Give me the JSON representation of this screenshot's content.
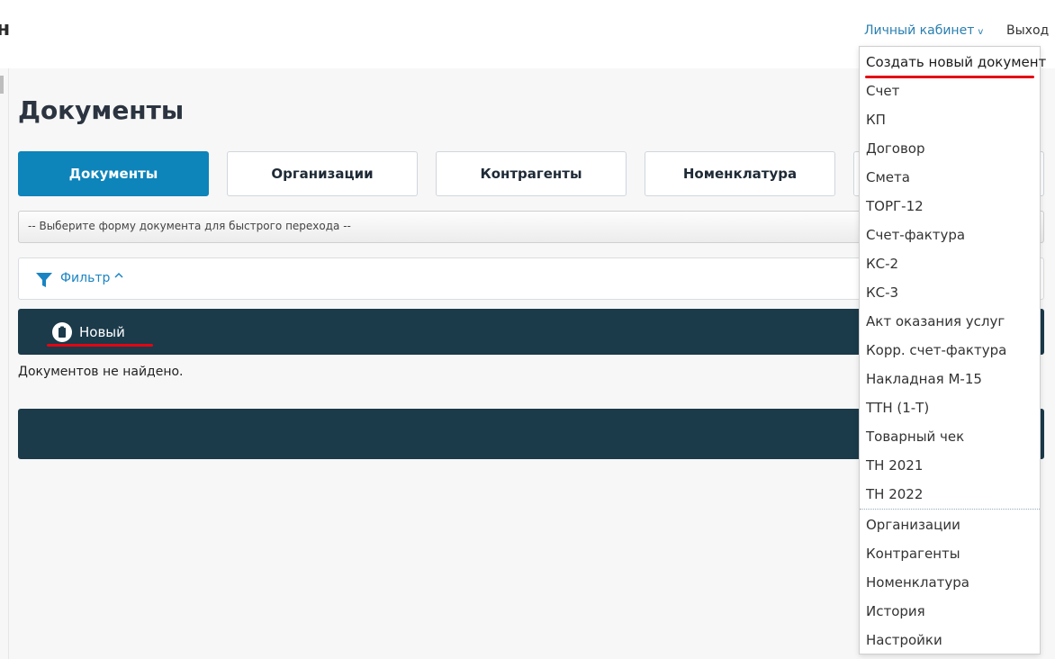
{
  "header": {
    "brand_fragment": "н",
    "account_label": "Личный кабинет",
    "account_chevron": "v",
    "logout_label": "Выход"
  },
  "page": {
    "title": "Документы",
    "empty_message": "Документов не найдено."
  },
  "tabs": [
    {
      "label": "Документы",
      "active": true
    },
    {
      "label": "Организации",
      "active": false
    },
    {
      "label": "Контрагенты",
      "active": false
    },
    {
      "label": "Номенклатура",
      "active": false
    }
  ],
  "quick_select": {
    "placeholder": "-- Выберите форму документа для быстрого перехода --"
  },
  "filter": {
    "label": "Фильтр",
    "chevron": "^"
  },
  "actions": {
    "new_label": "Новый"
  },
  "dropdown": {
    "header": "Создать новый документ",
    "documents": [
      "Счет",
      "КП",
      "Договор",
      "Смета",
      "ТОРГ-12",
      "Счет-фактура",
      "КС-2",
      "КС-3",
      "Акт оказания услуг",
      "Корр. счет-фактура",
      "Накладная М-15",
      "ТТН (1-Т)",
      "Товарный чек",
      "ТН 2021",
      "ТН 2022"
    ],
    "sections": [
      "Организации",
      "Контрагенты",
      "Номенклатура",
      "История",
      "Настройки"
    ]
  },
  "colors": {
    "primary": "#0d84ba",
    "dark_bar": "#1b3a4a",
    "accent_red": "#e30613",
    "link": "#1a84c3"
  }
}
